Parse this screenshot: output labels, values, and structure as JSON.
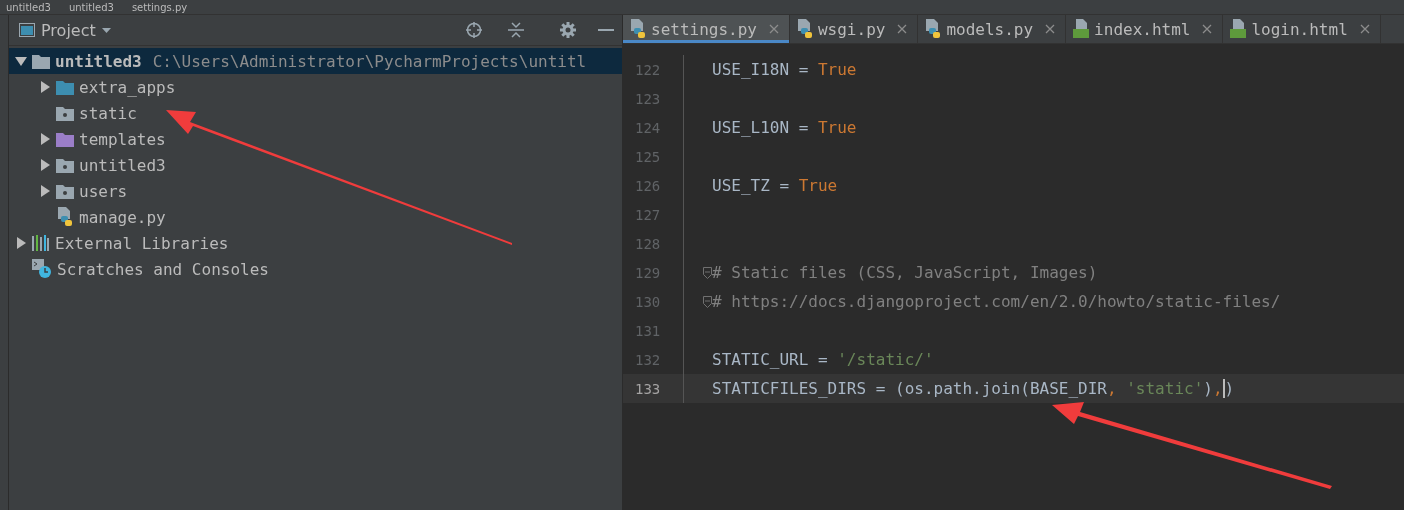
{
  "breadcrumbs": [
    "untitled3",
    "untitled3",
    "settings.py"
  ],
  "project_panel": {
    "title": "Project",
    "tree": [
      {
        "name": "untitled3",
        "path": "C:\\Users\\Administrator\\PycharmProjects\\untitl",
        "kind": "folder",
        "color": "#9aa7b0",
        "expanded": true,
        "selected": true,
        "children": [
          {
            "name": "extra_apps",
            "kind": "folder",
            "color": "#3d8eb0",
            "expanded": false,
            "selected": false
          },
          {
            "name": "static",
            "kind": "package",
            "color": "#9aa7b0",
            "selected": false
          },
          {
            "name": "templates",
            "kind": "folder",
            "color": "#9b7ec8",
            "expanded": false,
            "selected": false
          },
          {
            "name": "untitled3",
            "kind": "package",
            "color": "#9aa7b0",
            "expanded": false,
            "selected": false
          },
          {
            "name": "users",
            "kind": "package",
            "color": "#9aa7b0",
            "expanded": false,
            "selected": false
          },
          {
            "name": "manage.py",
            "kind": "python",
            "selected": false
          }
        ]
      },
      {
        "name": "External Libraries",
        "kind": "library",
        "expanded": false,
        "selected": false
      },
      {
        "name": "Scratches and Consoles",
        "kind": "scratches",
        "selected": false
      }
    ]
  },
  "editor": {
    "tabs": [
      {
        "label": "settings.py",
        "kind": "python",
        "selected": true
      },
      {
        "label": "wsgi.py",
        "kind": "python",
        "selected": false
      },
      {
        "label": "models.py",
        "kind": "python",
        "selected": false
      },
      {
        "label": "index.html",
        "kind": "html",
        "selected": false
      },
      {
        "label": "login.html",
        "kind": "html",
        "selected": false
      }
    ],
    "lines": [
      {
        "number": "122",
        "current": false,
        "fold": false,
        "tokens": [
          {
            "kind": "plain",
            "text": "USE_I18N = "
          },
          {
            "kind": "keyword",
            "text": "True"
          }
        ]
      },
      {
        "number": "123",
        "current": false,
        "fold": false
      },
      {
        "number": "124",
        "current": false,
        "fold": false,
        "tokens": [
          {
            "kind": "plain",
            "text": "USE_L10N = "
          },
          {
            "kind": "keyword",
            "text": "True"
          }
        ]
      },
      {
        "number": "125",
        "current": false,
        "fold": false
      },
      {
        "number": "126",
        "current": false,
        "fold": false,
        "tokens": [
          {
            "kind": "plain",
            "text": "USE_TZ = "
          },
          {
            "kind": "keyword",
            "text": "True"
          }
        ]
      },
      {
        "number": "127",
        "current": false,
        "fold": false
      },
      {
        "number": "128",
        "current": false,
        "fold": false
      },
      {
        "number": "129",
        "current": false,
        "fold": true,
        "tokens": [
          {
            "kind": "comment",
            "text": "# Static files (CSS, JavaScript, Images)"
          }
        ]
      },
      {
        "number": "130",
        "current": false,
        "fold": true,
        "tokens": [
          {
            "kind": "comment",
            "text": "# https://docs.djangoproject.com/en/2.0/howto/static-files/"
          }
        ]
      },
      {
        "number": "131",
        "current": false,
        "fold": false
      },
      {
        "number": "132",
        "current": false,
        "fold": false,
        "tokens": [
          {
            "kind": "plain",
            "text": "STATIC_URL = "
          },
          {
            "kind": "string",
            "text": "'/static/'"
          }
        ]
      },
      {
        "number": "133",
        "current": true,
        "fold": false,
        "tokens": [
          {
            "kind": "plain",
            "text": "STATICFILES_DIRS = (os.path.join(BASE_DIR"
          },
          {
            "kind": "keyword",
            "text": ", "
          },
          {
            "kind": "string",
            "text": "'static'"
          },
          {
            "kind": "plain",
            "text": ")"
          },
          {
            "kind": "keyword",
            "text": ","
          },
          {
            "kind": "caret",
            "text": ")"
          }
        ]
      }
    ]
  }
}
